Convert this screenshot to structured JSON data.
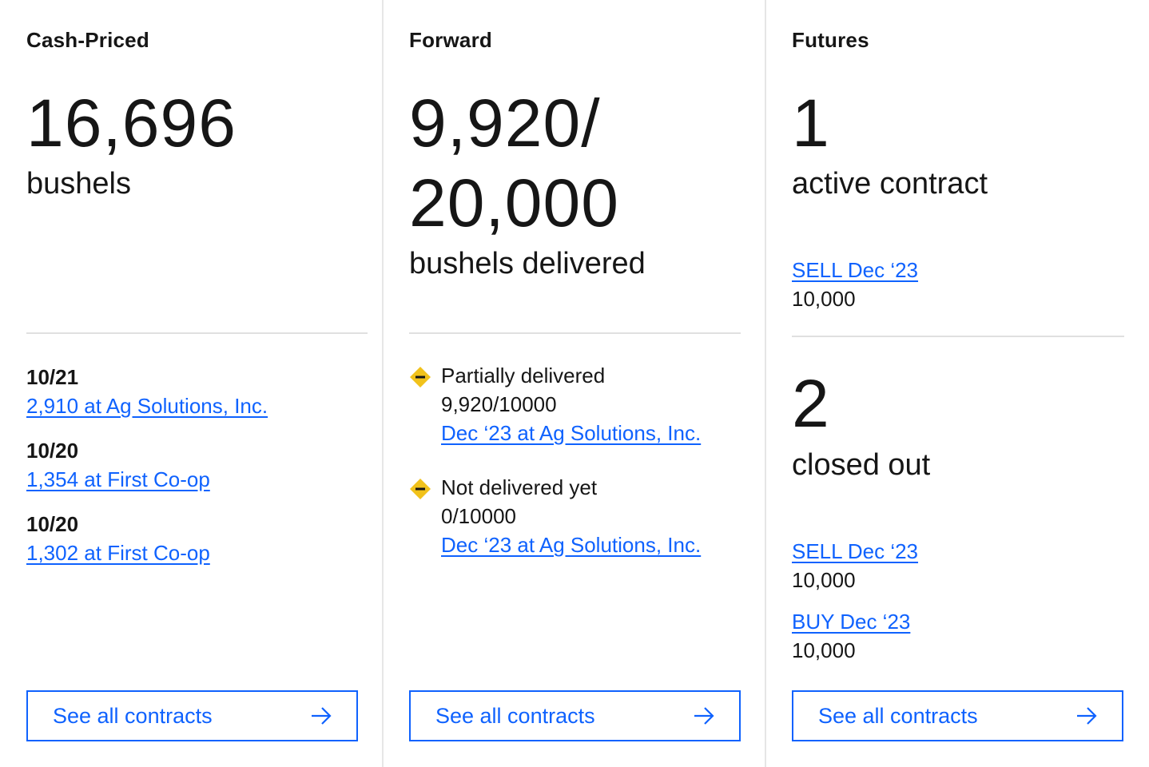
{
  "cash": {
    "title": "Cash-Priced",
    "total": "16,696",
    "unit": "bushels",
    "entries": [
      {
        "date": "10/21",
        "link": "2,910 at Ag Solutions, Inc."
      },
      {
        "date": "10/20",
        "link": "1,354 at First Co-op"
      },
      {
        "date": "10/20",
        "link": "1,302 at First Co-op"
      }
    ],
    "button": "See all contracts"
  },
  "forward": {
    "title": "Forward",
    "delivered_line1": "9,920/",
    "delivered_line2": "20,000",
    "unit": "bushels delivered",
    "items": [
      {
        "status": "Partially delivered",
        "progress": "9,920/10000",
        "link": "Dec ‘23 at Ag Solutions, Inc."
      },
      {
        "status": "Not delivered yet",
        "progress": "0/10000",
        "link": "Dec ‘23 at Ag Solutions, Inc."
      }
    ],
    "button": "See all contracts",
    "status_color": "#f1c21b"
  },
  "futures": {
    "title": "Futures",
    "active_count": "1",
    "active_label": "active contract",
    "active_items": [
      {
        "link": "SELL Dec ‘23",
        "qty": "10,000"
      }
    ],
    "closed_count": "2",
    "closed_label": "closed out",
    "closed_items": [
      {
        "link": "SELL Dec ‘23",
        "qty": "10,000"
      },
      {
        "link": "BUY Dec ‘23",
        "qty": "10,000"
      }
    ],
    "button": "See all contracts"
  },
  "colors": {
    "link": "#0f62fe",
    "text": "#161616",
    "divider": "#e0e0e0",
    "warning": "#f1c21b"
  }
}
